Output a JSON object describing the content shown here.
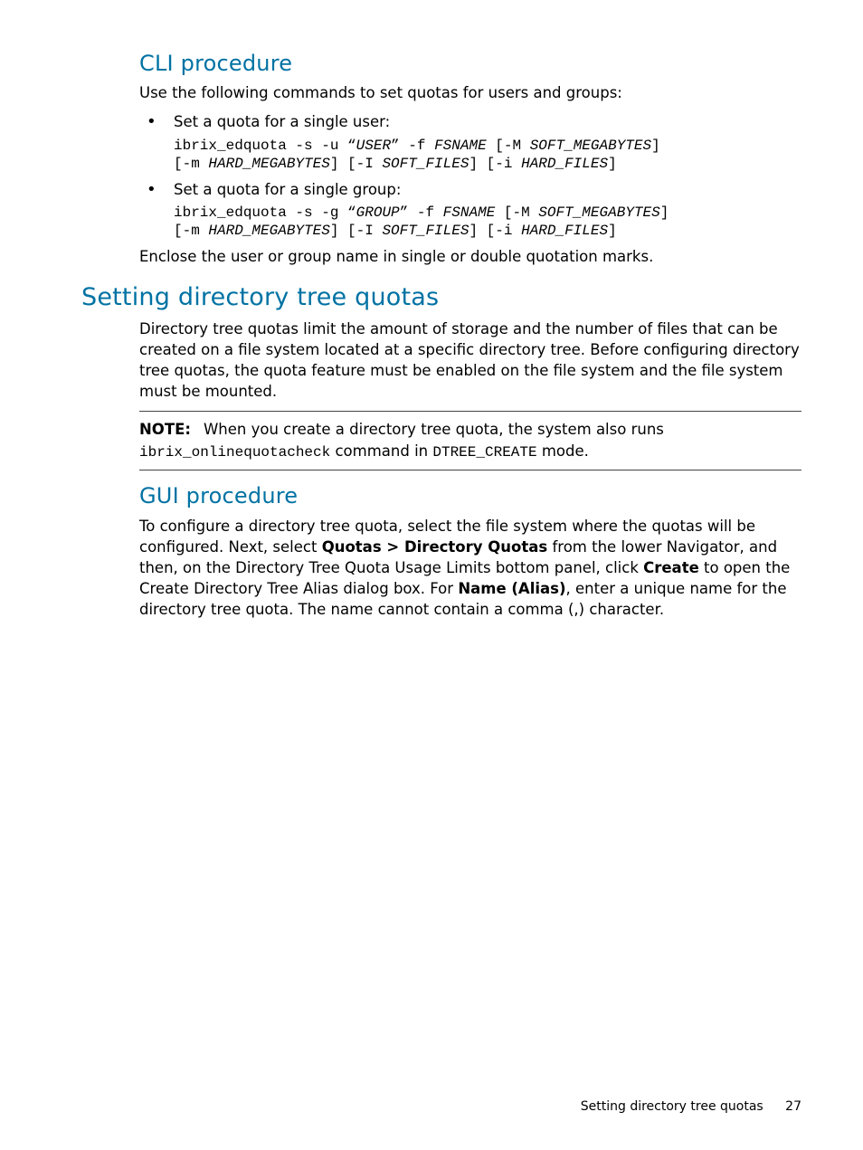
{
  "sec1": {
    "title": "CLI procedure",
    "intro": "Use the following commands to set quotas for users and groups:",
    "bullets": [
      {
        "lead": "Set a quota for a single user:",
        "code": {
          "p1": "ibrix_edquota -s -u “",
          "i1": "USER",
          "p2": "” -f ",
          "i2": "FSNAME",
          "p3": " [-M ",
          "i3": "SOFT_MEGABYTES",
          "p4": "]",
          "line2_p1": "[-m ",
          "line2_i1": "HARD_MEGABYTES",
          "line2_p2": "] [-I ",
          "line2_i2": "SOFT_FILES",
          "line2_p3": "] [-i ",
          "line2_i3": "HARD_FILES",
          "line2_p4": "]"
        }
      },
      {
        "lead": "Set a quota for a single group:",
        "code": {
          "p1": "ibrix_edquota -s -g “",
          "i1": "GROUP",
          "p2": "” -f ",
          "i2": "FSNAME",
          "p3": " [-M ",
          "i3": "SOFT_MEGABYTES",
          "p4": "]",
          "line2_p1": "[-m ",
          "line2_i1": "HARD_MEGABYTES",
          "line2_p2": "] [-I ",
          "line2_i2": "SOFT_FILES",
          "line2_p3": "] [-i ",
          "line2_i3": "HARD_FILES",
          "line2_p4": "]"
        }
      }
    ],
    "trailer": "Enclose the user or group name in single or double quotation marks."
  },
  "sec2": {
    "title": "Setting directory tree quotas",
    "para": "Directory tree quotas limit the amount of storage and the number of files that can be created on a file system located at a specific directory tree. Before configuring directory tree quotas, the quota feature must be enabled on the file system and the file system must be mounted.",
    "note": {
      "label": "NOTE:",
      "t1": "When you create a directory tree quota, the system also runs ",
      "c1": "ibrix_onlinequotacheck",
      "t2": " command in ",
      "c2": "DTREE_CREATE",
      "t3": " mode."
    }
  },
  "sec3": {
    "title": "GUI procedure",
    "para": {
      "t1": "To configure a directory tree quota, select the file system where the quotas will be configured. Next, select ",
      "b1": "Quotas > Directory Quotas",
      "t2": " from the lower Navigator, and then, on the Directory Tree Quota Usage Limits bottom panel, click ",
      "b2": "Create",
      "t3": " to open the Create Directory Tree Alias dialog box. For ",
      "b3": "Name (Alias)",
      "t4": ", enter a unique name for the directory tree quota. The name cannot contain a comma (,) character."
    }
  },
  "footer": {
    "text": "Setting directory tree quotas",
    "page": "27"
  }
}
